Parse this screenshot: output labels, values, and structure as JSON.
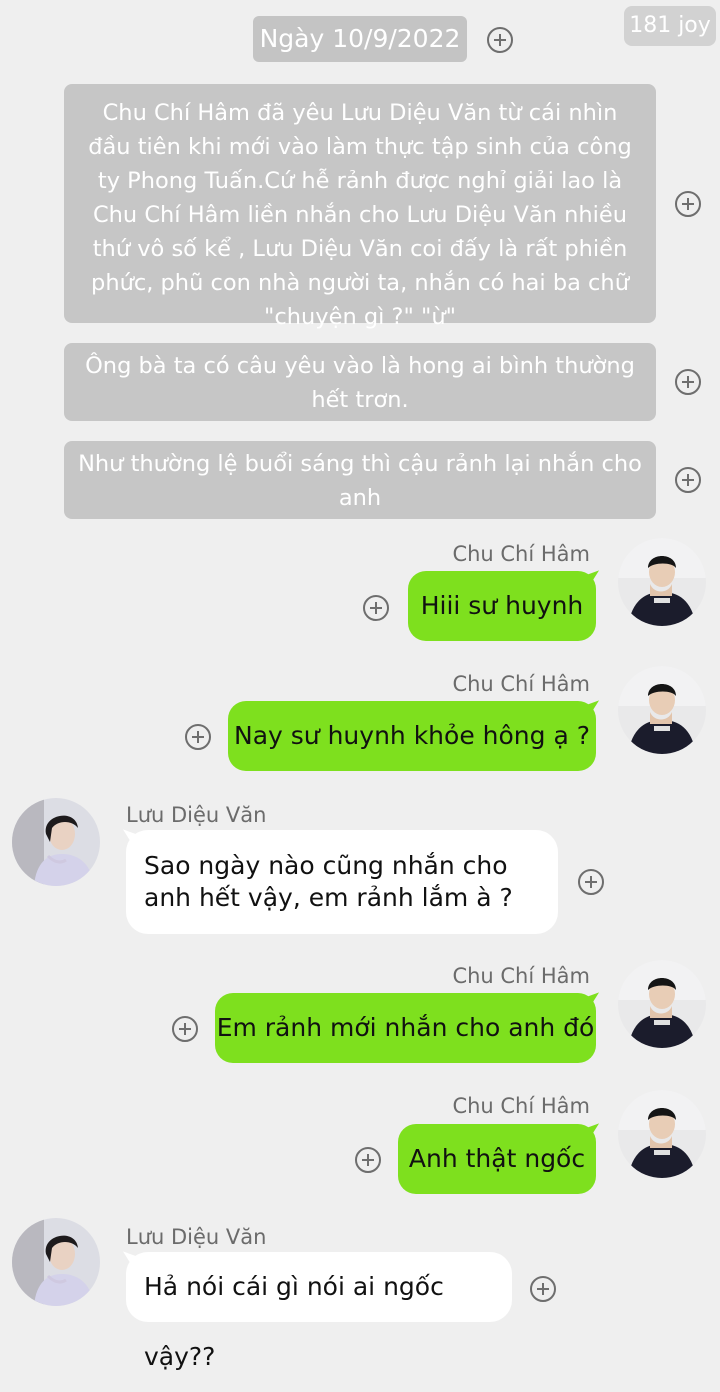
{
  "header": {
    "date": "Ngày 10/9/2022",
    "watermark": "181 joy"
  },
  "narration": [
    "Chu Chí Hâm đã yêu Lưu Diệu Văn từ cái nhìn đầu tiên khi mới vào làm thực tập sinh của công ty Phong Tuấn.Cứ hễ rảnh được nghỉ giải lao là Chu Chí Hâm liền nhắn cho Lưu Diệu Văn nhiều thứ vô số kể , Lưu Diệu Văn coi đấy là rất phiền phức, phũ con nhà người ta,  nhắn có hai ba chữ \"chuyện gì ?\" \"ừ\"",
    "Ông bà ta có câu yêu vào là hong ai bình thường hết trơn.",
    "Như thường lệ buổi sáng thì cậu rảnh lại nhắn cho anh"
  ],
  "messages": [
    {
      "sender": "Chu Chí Hâm",
      "side": "right",
      "text": "Hiii sư huynh"
    },
    {
      "sender": "Chu Chí Hâm",
      "side": "right",
      "text": "Nay sư huynh khỏe hông ạ ?"
    },
    {
      "sender": "Lưu Diệu Văn",
      "side": "left",
      "text": "Sao ngày nào cũng nhắn cho anh hết vậy, em rảnh lắm à ?"
    },
    {
      "sender": "Chu Chí Hâm",
      "side": "right",
      "text": "Em rảnh mới nhắn cho anh đó"
    },
    {
      "sender": "Chu Chí Hâm",
      "side": "right",
      "text": "Anh thật ngốc"
    },
    {
      "sender": "Lưu Diệu Văn",
      "side": "left",
      "text": "Hả nói cái gì nói ai ngốc vậy??"
    }
  ],
  "colors": {
    "background": "#efefef",
    "narration_bubble": "#c6c6c6",
    "outgoing_bubble": "#7ee01e",
    "incoming_bubble": "#ffffff"
  },
  "icons": {
    "add": "plus-circle-icon",
    "avatar_chu": "avatar-chu-chi-ham",
    "avatar_luu": "avatar-luu-dieu-van"
  }
}
